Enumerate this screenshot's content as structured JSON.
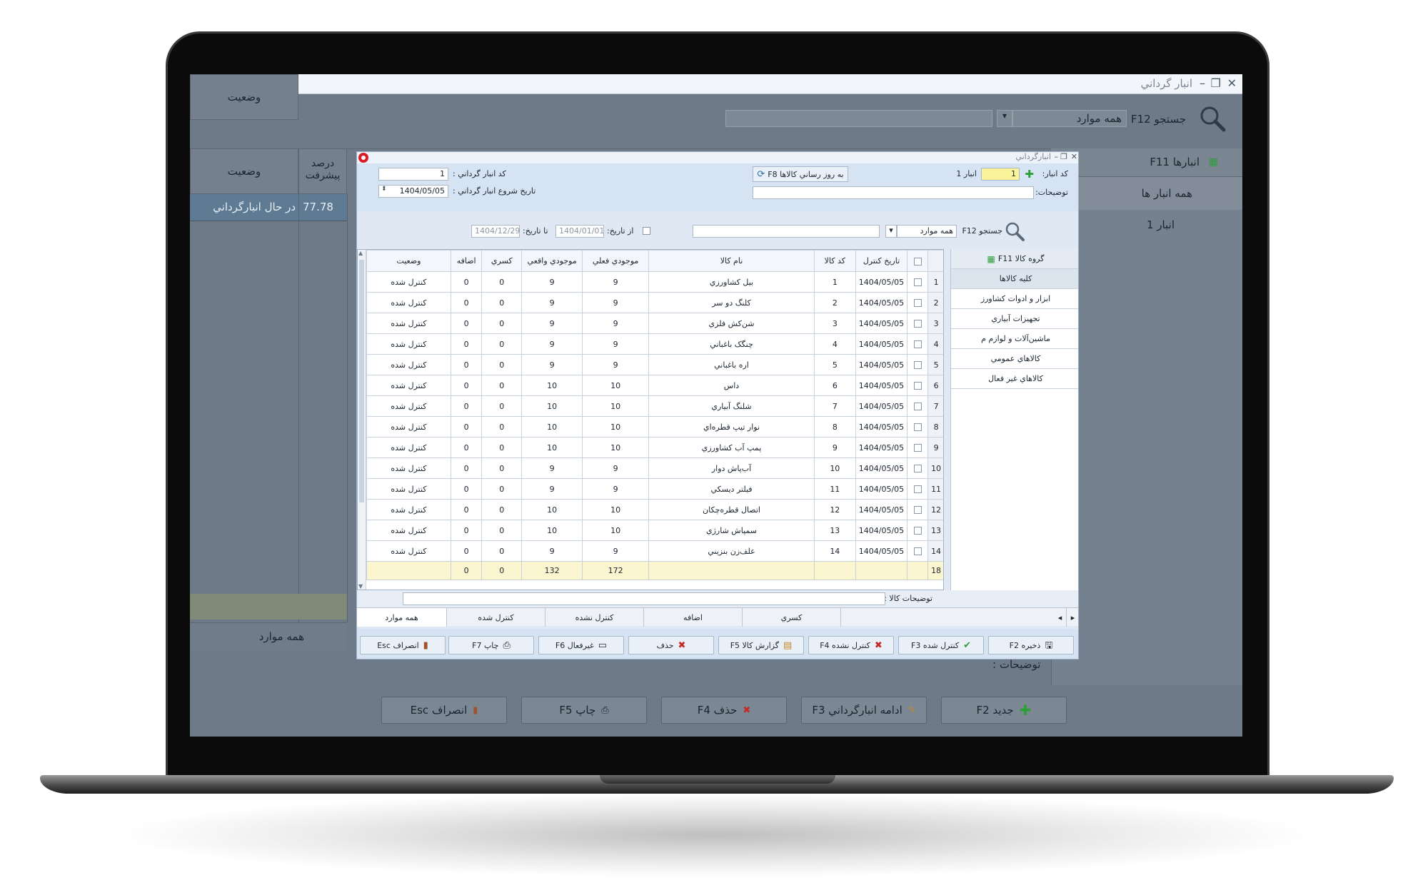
{
  "main": {
    "title": "انبار گرداني",
    "search_label": "جستجو F12",
    "search_filter": "همه موارد",
    "search_value": "",
    "grid_headers": [
      "وضعيت",
      "درصد پيشرفت"
    ],
    "grid_row": {
      "status": "در حال انبارگرداني",
      "progress": "77.78"
    },
    "bottom_tab": "همه موارد",
    "description_label": "توضيحات :",
    "warehouses_title": "انبارها F11",
    "all_warehouses": "همه انبار ها",
    "warehouse_1": "انبار 1",
    "buttons": {
      "new": "جديد F2",
      "continue": "ادامه انبارگرداني F3",
      "delete": "حذف F4",
      "print": "چاپ F5",
      "cancel": "انصراف Esc"
    }
  },
  "dialog": {
    "title": "انبارگرداني",
    "inventory_code_label": "کد انبار گرداني :",
    "inventory_code_value": "1",
    "start_date_label": "تاريخ شروع انبار گرداني :",
    "start_date_value": "1404/05/05",
    "update_button": "به روز رساني کالاها F8",
    "warehouse_code_label": "کد انبار:",
    "warehouse_code_value": "1",
    "warehouse_name": "انبار 1",
    "description_label": "توضيحات:",
    "description_value": "",
    "search_label": "جستجو F12",
    "search_filter": "همه موارد",
    "search_value": "",
    "from_date_label": "از تاريخ:",
    "from_date_value": "1404/01/01",
    "to_date_label": "تا تاريخ:",
    "to_date_value": "1404/12/29",
    "columns": [
      "وضعيت",
      "اضافه",
      "کسري",
      "موجودي واقعي",
      "موجودي فعلي",
      "نام کالا",
      "کد کالا",
      "تاريخ کنترل"
    ],
    "rows": [
      {
        "n": "1",
        "date": "1404/05/05",
        "code": "1",
        "name": "بيل کشاورزي",
        "current": "9",
        "actual": "9",
        "deficit": "0",
        "surplus": "0",
        "status": "کنترل شده"
      },
      {
        "n": "2",
        "date": "1404/05/05",
        "code": "2",
        "name": "کلنگ دو سر",
        "current": "9",
        "actual": "9",
        "deficit": "0",
        "surplus": "0",
        "status": "کنترل شده"
      },
      {
        "n": "3",
        "date": "1404/05/05",
        "code": "3",
        "name": "شن‌کش فلزي",
        "current": "9",
        "actual": "9",
        "deficit": "0",
        "surplus": "0",
        "status": "کنترل شده"
      },
      {
        "n": "4",
        "date": "1404/05/05",
        "code": "4",
        "name": "چنگک باغباني",
        "current": "9",
        "actual": "9",
        "deficit": "0",
        "surplus": "0",
        "status": "کنترل شده"
      },
      {
        "n": "5",
        "date": "1404/05/05",
        "code": "5",
        "name": "اره باغباني",
        "current": "9",
        "actual": "9",
        "deficit": "0",
        "surplus": "0",
        "status": "کنترل شده"
      },
      {
        "n": "6",
        "date": "1404/05/05",
        "code": "6",
        "name": "داس",
        "current": "10",
        "actual": "10",
        "deficit": "0",
        "surplus": "0",
        "status": "کنترل شده"
      },
      {
        "n": "7",
        "date": "1404/05/05",
        "code": "7",
        "name": "شلنگ آبياري",
        "current": "10",
        "actual": "10",
        "deficit": "0",
        "surplus": "0",
        "status": "کنترل شده"
      },
      {
        "n": "8",
        "date": "1404/05/05",
        "code": "8",
        "name": "نوار تيپ قطره‌اي",
        "current": "10",
        "actual": "10",
        "deficit": "0",
        "surplus": "0",
        "status": "کنترل شده"
      },
      {
        "n": "9",
        "date": "1404/05/05",
        "code": "9",
        "name": "پمپ آب کشاورزي",
        "current": "10",
        "actual": "10",
        "deficit": "0",
        "surplus": "0",
        "status": "کنترل شده"
      },
      {
        "n": "10",
        "date": "1404/05/05",
        "code": "10",
        "name": "آب‌پاش دوار",
        "current": "9",
        "actual": "9",
        "deficit": "0",
        "surplus": "0",
        "status": "کنترل شده"
      },
      {
        "n": "11",
        "date": "1404/05/05",
        "code": "11",
        "name": "فيلتر ديسکي",
        "current": "9",
        "actual": "9",
        "deficit": "0",
        "surplus": "0",
        "status": "کنترل شده"
      },
      {
        "n": "12",
        "date": "1404/05/05",
        "code": "12",
        "name": "اتصال قطره‌چکان",
        "current": "10",
        "actual": "10",
        "deficit": "0",
        "surplus": "0",
        "status": "کنترل شده"
      },
      {
        "n": "13",
        "date": "1404/05/05",
        "code": "13",
        "name": "سمپاش شارژي",
        "current": "10",
        "actual": "10",
        "deficit": "0",
        "surplus": "0",
        "status": "کنترل شده"
      },
      {
        "n": "14",
        "date": "1404/05/05",
        "code": "14",
        "name": "علف‌زن بنزيني",
        "current": "9",
        "actual": "9",
        "deficit": "0",
        "surplus": "0",
        "status": "کنترل شده"
      }
    ],
    "totals": {
      "n": "18",
      "current": "172",
      "actual": "132",
      "deficit": "0",
      "surplus": "0"
    },
    "groups_title": "گروه کالا F11",
    "groups": [
      "کليه کالاها",
      "ابزار و ادوات کشاورز",
      "تجهيزات آبياري",
      "ماشين‌آلات و لوازم م",
      "کالاهاي عمومي",
      "کالاهاي غير فعال"
    ],
    "item_description_label": "توضيحات کالا :",
    "item_description_value": "",
    "tabs": [
      "همه موارد",
      "کنترل شده",
      "کنترل نشده",
      "اضافه",
      "کسري"
    ],
    "buttons": {
      "save": "ذخيره F2",
      "checked": "کنترل شده F3",
      "unchecked": "کنترل نشده F4",
      "report": "گزارش کالا F5",
      "delete": "حذف",
      "inactive": "غيرفعال F6",
      "print": "چاپ F7",
      "cancel": "انصراف Esc"
    }
  },
  "colors": {
    "accent_red": "#d81b27",
    "green": "#2e9e3b",
    "total_row": "#fbf6cf"
  }
}
